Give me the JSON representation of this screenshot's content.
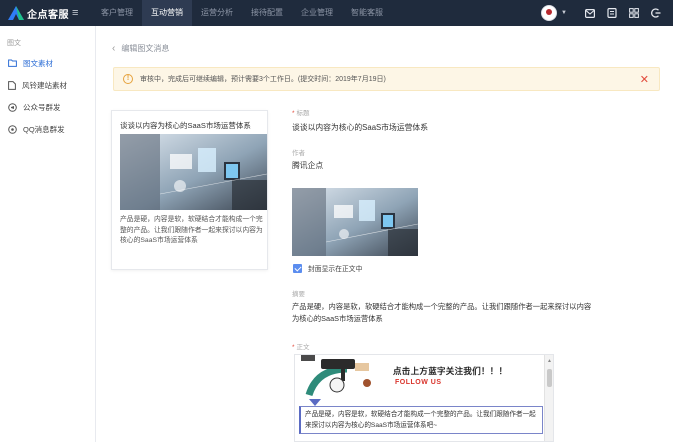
{
  "app": {
    "name": "企点客服"
  },
  "topnav": {
    "items": [
      {
        "label": "客户管理",
        "active": false
      },
      {
        "label": "互动营销",
        "active": true
      },
      {
        "label": "运营分析",
        "active": false
      },
      {
        "label": "接待配置",
        "active": false
      },
      {
        "label": "企业管理",
        "active": false
      },
      {
        "label": "智能客服",
        "active": false
      }
    ]
  },
  "sidebar": {
    "section": "图文",
    "items": [
      {
        "label": "图文素材",
        "icon": "folder-icon",
        "active": true
      },
      {
        "label": "风铃建站素材",
        "icon": "file-icon",
        "active": false
      },
      {
        "label": "公众号群发",
        "icon": "broadcast-icon",
        "active": false
      },
      {
        "label": "QQ消息群发",
        "icon": "qq-icon",
        "active": false
      }
    ]
  },
  "breadcrumb": {
    "label": "编辑图文消息"
  },
  "alert": {
    "text": "审核中，完成后可继续编辑，预计需要3个工作日。(提交时间：2019年7月19日)"
  },
  "preview": {
    "title": "谈谈以内容为核心的SaaS市场运营体系",
    "description": "产品是硬，内容是软，软硬结合才能构成一个完整的产品。让我们跟随作者一起来探讨以内容为核心的SaaS市场运营体系"
  },
  "form": {
    "title_label": "标题",
    "title_value": "谈谈以内容为核心的SaaS市场运营体系",
    "author_label": "作者",
    "author_value": "腾讯企点",
    "cover_checkbox_label": "封面显示在正文中",
    "cover_checked": true,
    "summary_label": "摘要",
    "summary_value": "产品是硬，内容是软，软硬结合才能构成一个完整的产品。让我们跟随作者一起来探讨以内容为核心的SaaS市场运营体系",
    "body_label": "正文"
  },
  "editor": {
    "follow_cn": "点击上方蓝字关注我们！！！",
    "follow_en": "FOLLOW US",
    "body_text": "产品是硬，内容是软，软硬结合才能构成一个完整的产品。让我们跟随作者一起来探讨以内容为核心的SaaS市场运营体系吧~"
  },
  "colors": {
    "topbar": "#1f2b3d",
    "accent": "#2f6fd6",
    "alert_bg": "#fdf6e6",
    "warn": "#e6a23c",
    "danger": "#e24a3b"
  }
}
